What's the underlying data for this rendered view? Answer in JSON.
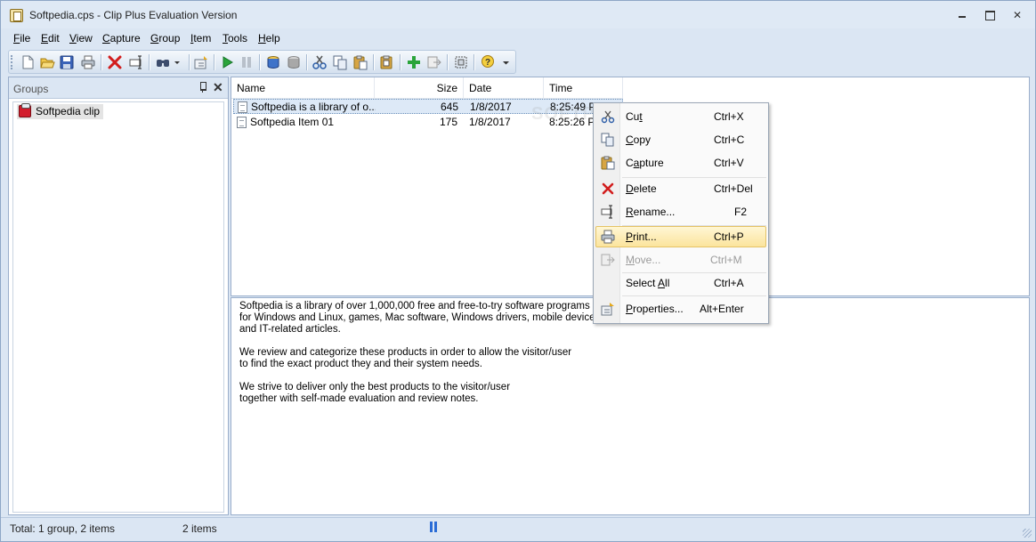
{
  "window": {
    "title": "Softpedia.cps - Clip Plus Evaluation Version"
  },
  "menubar": {
    "items": [
      {
        "label": "File",
        "hotkey": "F",
        "rest": "ile"
      },
      {
        "label": "Edit",
        "hotkey": "E",
        "rest": "dit"
      },
      {
        "label": "View",
        "hotkey": "V",
        "rest": "iew"
      },
      {
        "label": "Capture",
        "hotkey": "C",
        "rest": "apture"
      },
      {
        "label": "Group",
        "hotkey": "G",
        "rest": "roup"
      },
      {
        "label": "Item",
        "hotkey": "I",
        "rest": "tem"
      },
      {
        "label": "Tools",
        "hotkey": "T",
        "rest": "ools"
      },
      {
        "label": "Help",
        "hotkey": "H",
        "rest": "elp"
      }
    ]
  },
  "toolbar": {
    "icons": [
      "new-icon",
      "open-icon",
      "save-icon",
      "print-icon",
      "delete-icon",
      "rename-icon",
      "find-icon",
      "properties-icon",
      "start-capture-icon",
      "pause-capture-icon",
      "group-icon",
      "group-disabled-icon",
      "cut-icon",
      "copy-icon",
      "paste-icon",
      "capture-icon",
      "add-icon",
      "move-icon",
      "select-icon",
      "help-icon"
    ]
  },
  "groups": {
    "title": "Groups",
    "nodes": [
      {
        "label": "Softpedia clip"
      }
    ]
  },
  "list": {
    "columns": {
      "name": "Name",
      "size": "Size",
      "date": "Date",
      "time": "Time"
    },
    "rows": [
      {
        "name": "Softpedia is a library of o...",
        "size": "645",
        "date": "1/8/2017",
        "time": "8:25:49 PM"
      },
      {
        "name": "Softpedia Item 01",
        "size": "175",
        "date": "1/8/2017",
        "time": "8:25:26 PM"
      }
    ]
  },
  "preview": {
    "lines": [
      "Softpedia is a library of over 1,000,000 free and free-to-try software programs",
      "for Windows and Linux, games, Mac software, Windows drivers, mobile devices",
      "and IT-related articles.",
      "",
      "We review and categorize these products in order to allow the visitor/user",
      "to find the exact product they and their system needs.",
      "",
      "We strive to deliver only the best products to the visitor/user",
      "together with self-made evaluation and review notes."
    ]
  },
  "context_menu": {
    "items": [
      {
        "label_pre": "Cu",
        "label_u": "t",
        "label_post": "",
        "shortcut": "Ctrl+X",
        "icon": "cut-icon"
      },
      {
        "label_pre": "",
        "label_u": "C",
        "label_post": "opy",
        "shortcut": "Ctrl+C",
        "icon": "copy-icon"
      },
      {
        "label_pre": "C",
        "label_u": "a",
        "label_post": "pture",
        "shortcut": "Ctrl+V",
        "icon": "capture-icon"
      },
      {
        "label_pre": "",
        "label_u": "D",
        "label_post": "elete",
        "shortcut": "Ctrl+Del",
        "icon": "delete-icon"
      },
      {
        "label_pre": "",
        "label_u": "R",
        "label_post": "ename...",
        "shortcut": "F2",
        "icon": "rename-icon"
      },
      {
        "label_pre": "",
        "label_u": "P",
        "label_post": "rint...",
        "shortcut": "Ctrl+P",
        "icon": "print-icon"
      },
      {
        "label_pre": "",
        "label_u": "M",
        "label_post": "ove...",
        "shortcut": "Ctrl+M",
        "icon": "move-icon"
      },
      {
        "label_pre": "Select ",
        "label_u": "A",
        "label_post": "ll",
        "shortcut": "Ctrl+A",
        "icon": ""
      },
      {
        "label_pre": "",
        "label_u": "P",
        "label_post": "roperties...",
        "shortcut": "Alt+Enter",
        "icon": "properties-icon"
      }
    ]
  },
  "statusbar": {
    "summary": "Total: 1 group, 2 items",
    "count": "2 items"
  },
  "watermark": "SOFTPEDIA"
}
